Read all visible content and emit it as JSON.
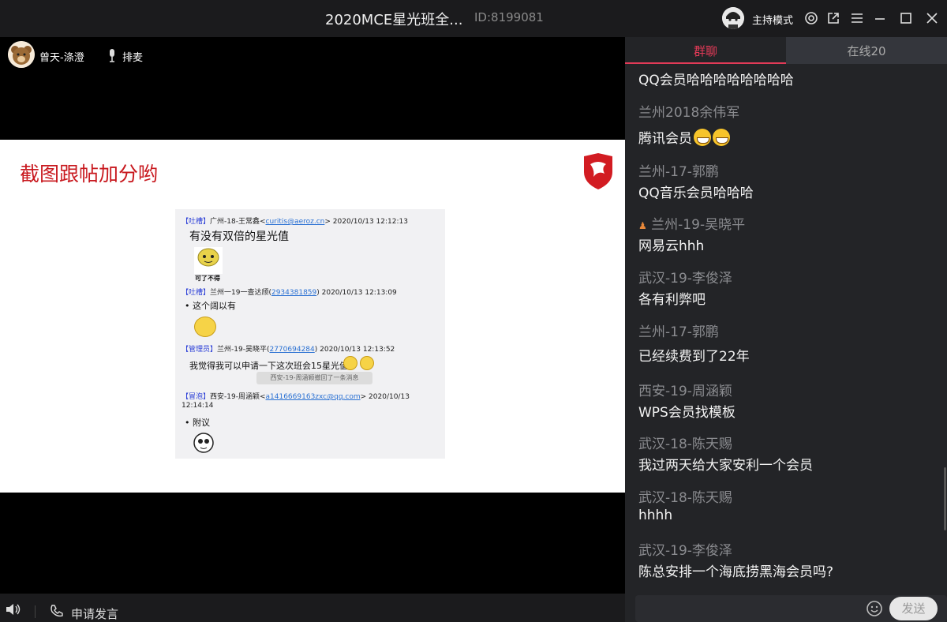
{
  "titlebar": {
    "title": "2020MCE星光班全...",
    "room_id": "ID:8199081",
    "host_mode": "主持模式",
    "icons": [
      "avatar",
      "settings-icon",
      "popout-icon",
      "menu-icon",
      "minimize-icon",
      "maximize-icon",
      "close-icon"
    ]
  },
  "userbar": {
    "user_name": "曾天-涤澄",
    "queue_label": "排麦"
  },
  "slide": {
    "title": "截图跟帖加分哟",
    "brand_color": "#c8181e",
    "screenshot": {
      "lines": [
        {
          "tag": "【吐槽】",
          "name": "广州-18-王常鑫<",
          "link": "curitis@aeroz.cn",
          "tail": "> 2020/10/13 12:12:13"
        },
        {
          "text": "有没有双倍的星光值"
        },
        {
          "sticker_caption": "可了不得"
        },
        {
          "tag": "【吐槽】",
          "name": "兰州一19一查达颀(",
          "link": "2934381859",
          "tail": ") 2020/10/13 12:13:09"
        },
        {
          "text": "这个阔以有"
        },
        {
          "tag": "【管理员】",
          "name": "兰州-19-吴晓平(",
          "link": "2770694284",
          "tail": ") 2020/10/13 12:13:52"
        },
        {
          "text": "我觉得我可以申请一下这次班会15星光值"
        },
        {
          "recall": "西安-19-周涵颖撤回了一条消息"
        },
        {
          "tag": "【冒泡】",
          "name": "西安-19-周涵颖<",
          "link": "a1416669163zxc@qq.com",
          "tail": "> 2020/10/13"
        },
        {
          "text": "12:14:14"
        },
        {
          "text": "附议"
        }
      ]
    }
  },
  "bottombar": {
    "apply_label": "申请发言"
  },
  "sidebar": {
    "tabs": [
      {
        "label": "群聊",
        "active": true
      },
      {
        "label": "在线20",
        "active": false
      }
    ],
    "messages": [
      {
        "name": "",
        "text": "QQ会员哈哈哈哈哈哈哈哈"
      },
      {
        "name": "兰州2018余伟军",
        "text": "腾讯会员"
      },
      {
        "name": "兰州-17-郭鹏",
        "text": "QQ音乐会员哈哈哈"
      },
      {
        "name": "兰州-19-吴晓平",
        "text": "网易云hhh"
      },
      {
        "name": "武汉-19-李俊泽",
        "text": "各有利弊吧"
      },
      {
        "name": "兰州-17-郭鹏",
        "text": "已经续费到了22年"
      },
      {
        "name": "西安-19-周涵颖",
        "text": "WPS会员找模板"
      },
      {
        "name": "武汉-18-陈天赐",
        "text": "我过两天给大家安利一个会员"
      },
      {
        "name": "武汉-18-陈天赐",
        "text": "hhhh"
      },
      {
        "name": "武汉-19-李俊泽",
        "text": "陈总安排一个海底捞黑海会员吗?"
      }
    ],
    "input_placeholder": "",
    "send_label": "发送",
    "active_color": "#e23a57"
  }
}
